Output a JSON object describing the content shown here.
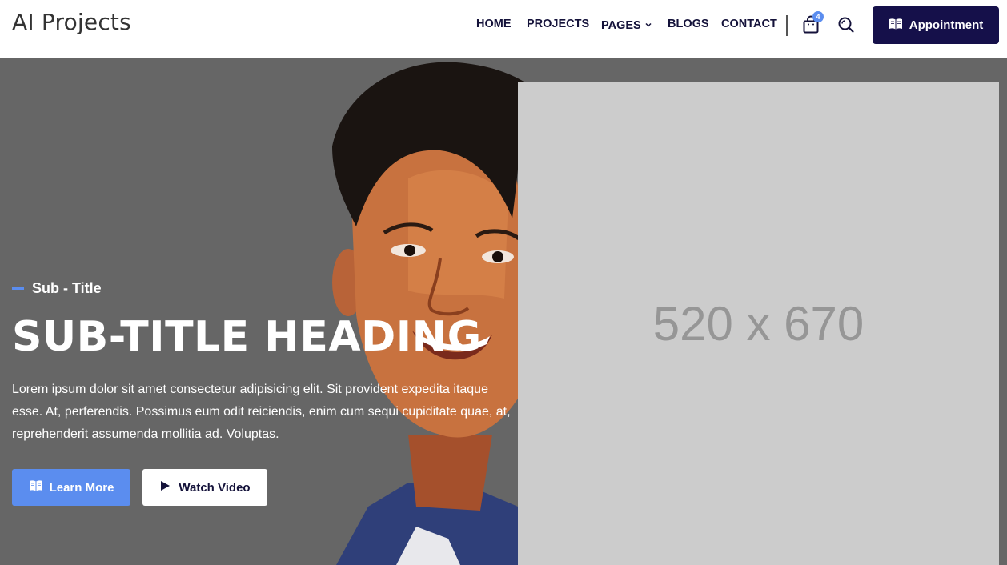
{
  "brand": {
    "name": "AI Projects"
  },
  "nav": {
    "items": [
      {
        "label": "HOME"
      },
      {
        "label": "PROJECTS"
      },
      {
        "label": "PAGES"
      },
      {
        "label": "BLOGS"
      },
      {
        "label": "CONTACT"
      }
    ],
    "cart_count": "4",
    "icons": {
      "cart": "shopping-bag-icon",
      "search": "search-icon",
      "dropdown": "chevron-down-icon"
    }
  },
  "appointment": {
    "label": "Appointment",
    "icon": "book-icon"
  },
  "hero": {
    "subtitle": "Sub - Title",
    "heading": "SUB-TITLE HEADING",
    "body": "Lorem ipsum dolor sit amet consectetur adipisicing elit. Sit provident expedita itaque esse. At, perferendis. Possimus eum odit reiciendis, enim cum sequi cupiditate quae, at, reprehenderit assumenda mollitia ad. Voluptas.",
    "learn_more": "Learn More",
    "watch_video": "Watch Video",
    "placeholder_text": "520 x 670"
  },
  "colors": {
    "accent": "#5b8def",
    "navy": "#15104a",
    "hero_bg": "#666666",
    "placeholder_bg": "#cccccc"
  }
}
